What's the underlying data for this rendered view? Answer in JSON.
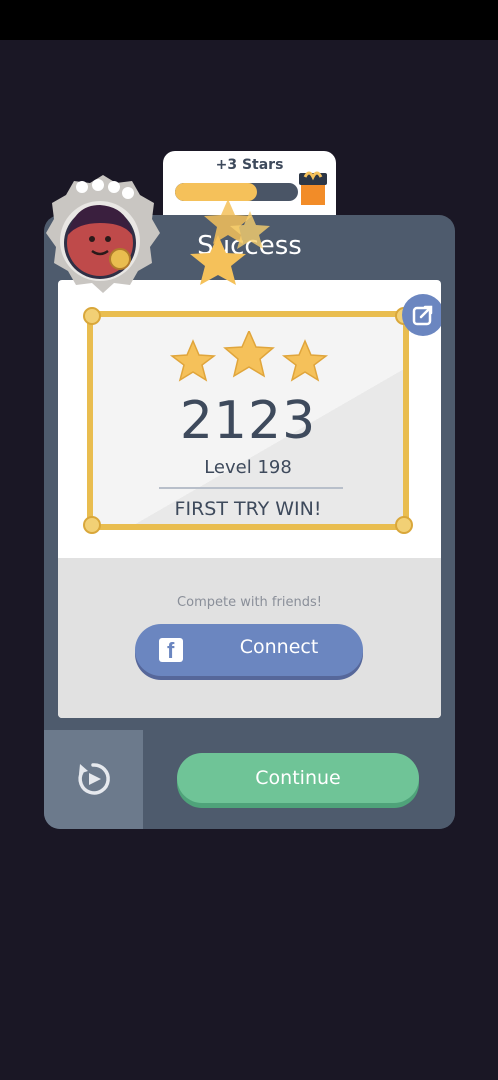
{
  "header": {
    "stars_earned": "+3 Stars",
    "stars_progress": 0.67
  },
  "card": {
    "title": "Success",
    "score": "2123",
    "level": "Level 198",
    "result": "FIRST TRY WIN!",
    "stars_awarded": 3,
    "compete_text": "Compete with friends!",
    "connect_label": "Connect",
    "continue_label": "Continue"
  },
  "colors": {
    "background": "#1a1725",
    "card": "#4e5b6d",
    "accent_green": "#6fc497",
    "facebook_blue": "#6b86c0",
    "gold": "#e9bd4f"
  },
  "icons": [
    "gift-icon",
    "share-icon",
    "facebook-icon",
    "replay-icon",
    "avatar-icon",
    "star-icon"
  ]
}
